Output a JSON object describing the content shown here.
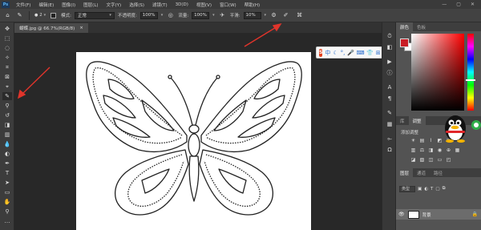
{
  "menubar": {
    "app_logo": "Ps",
    "items": [
      "文件(F)",
      "编辑(E)",
      "图像(I)",
      "图层(L)",
      "文字(Y)",
      "选择(S)",
      "滤镜(T)",
      "3D(D)",
      "视图(V)",
      "窗口(W)",
      "帮助(H)"
    ],
    "window_controls": [
      "—",
      "▢",
      "✕"
    ]
  },
  "options_bar": {
    "brush_size": "2",
    "mode_label": "模式:",
    "mode_value": "正常",
    "opacity_label": "不透明度:",
    "opacity_value": "100%",
    "flow_label": "流量:",
    "flow_value": "100%",
    "smoothing_label": "平滑:",
    "smoothing_value": "10%"
  },
  "document": {
    "tab_title": "蝴蝶.jpg @ 66.7%(RGB/8)",
    "tab_close": "×"
  },
  "floating_toolbar": {
    "brand": "S",
    "lang": "中",
    "icons": [
      "moon-icon",
      "comma-icon",
      "microphone-icon",
      "keyboard-icon",
      "shirt-icon",
      "grid-icon",
      "wrench-icon"
    ]
  },
  "right_panel": {
    "color_tabs": [
      "颜色",
      "色板"
    ],
    "mid_tabs": [
      "库",
      "调整"
    ],
    "adjust_title": "添加调整",
    "layer_tabs": [
      "图层",
      "通道",
      "路径"
    ],
    "layer_filter": "类型",
    "layer_name": "背景",
    "colors": {
      "foreground": "#c81d25",
      "background": "#ffffff"
    }
  },
  "annotations": {
    "arrow_color": "#e0342b"
  }
}
